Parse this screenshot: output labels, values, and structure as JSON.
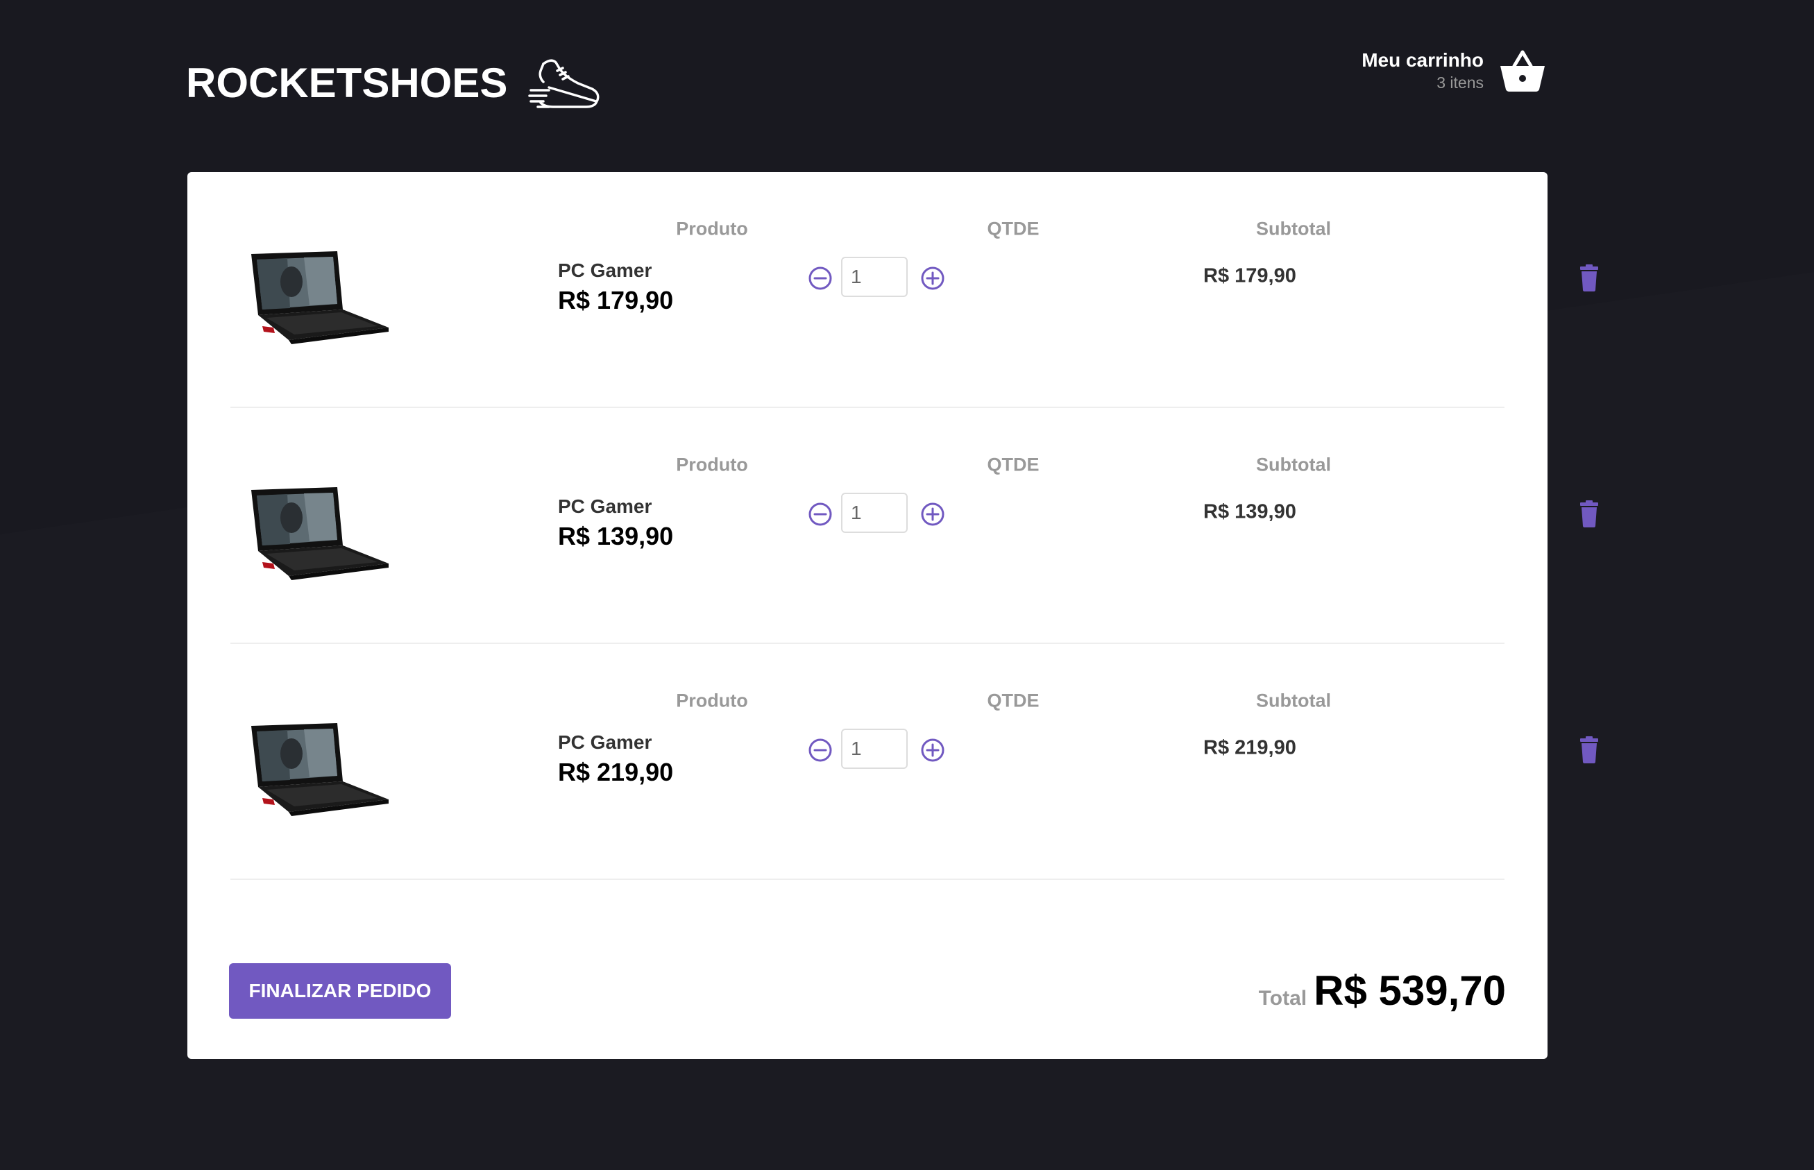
{
  "colors": {
    "background": "#191920",
    "accent": "#7159c1",
    "card": "#ffffff",
    "muted_text": "#999999"
  },
  "header": {
    "logo_text": "ROCKETSHOES",
    "logo_icon": "running-shoe-icon",
    "cart_title": "Meu carrinho",
    "cart_count": "3 itens",
    "cart_icon": "shopping-basket-icon"
  },
  "table": {
    "columns": [
      "Produto",
      "QTDE",
      "Subtotal"
    ]
  },
  "products": [
    {
      "name": "PC Gamer",
      "price": "R$ 179,90",
      "quantity": "1",
      "subtotal": "R$ 179,90",
      "image": "gaming-laptop-image"
    },
    {
      "name": "PC Gamer",
      "price": "R$ 139,90",
      "quantity": "1",
      "subtotal": "R$ 139,90",
      "image": "gaming-laptop-image"
    },
    {
      "name": "PC Gamer",
      "price": "R$ 219,90",
      "quantity": "1",
      "subtotal": "R$ 219,90",
      "image": "gaming-laptop-image"
    }
  ],
  "icons": {
    "decrement": "minus-circle-icon",
    "increment": "plus-circle-icon",
    "remove": "trash-icon"
  },
  "footer": {
    "checkout_label": "Finalizar pedido",
    "total_label": "Total",
    "total_value": "R$ 539,70"
  }
}
